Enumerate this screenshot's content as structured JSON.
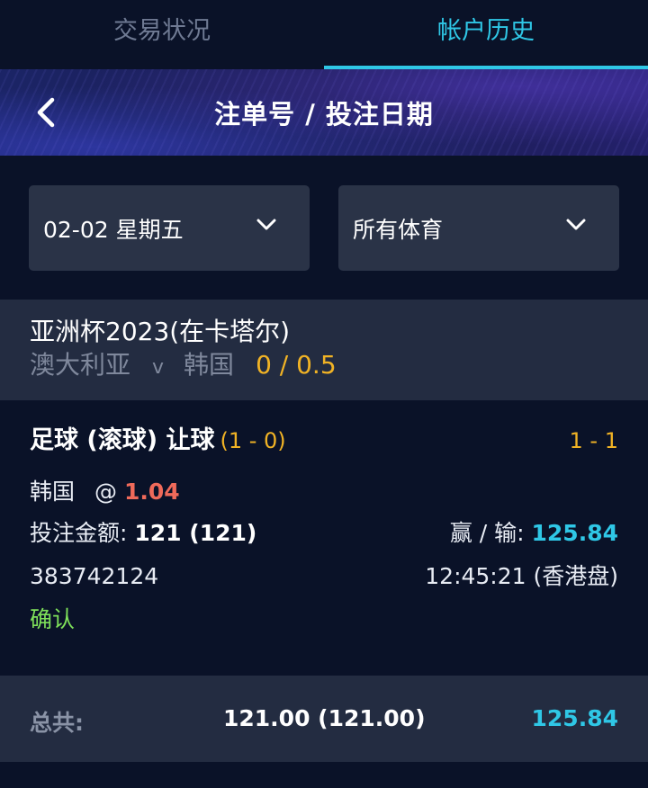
{
  "tabs": [
    {
      "label": "交易状况",
      "active": false
    },
    {
      "label": "帐户历史",
      "active": true
    }
  ],
  "header": {
    "title": "注单号 / 投注日期",
    "back_icon": "chevron-left-icon"
  },
  "filters": {
    "date": {
      "selected": "02-02 星期五"
    },
    "sport": {
      "selected": "所有体育"
    }
  },
  "event": {
    "league": "亚洲杯2023(在卡塔尔)",
    "home": "澳大利亚",
    "vs": "v",
    "away": "韩国",
    "handicap": "0 / 0.5"
  },
  "bet": {
    "market": "足球 (滚球) 让球",
    "market_score": "(1 - 0)",
    "final_score": "1 - 1",
    "selection": "韩国",
    "at": "@",
    "odds": "1.04",
    "stake_label": "投注金额:",
    "stake_value": "121 (121)",
    "winloss_label": "赢 / 输:",
    "winloss_value": "125.84",
    "ticket_id": "383742124",
    "time": "12:45:21 (香港盘)",
    "status": "确认"
  },
  "total": {
    "label": "总共:",
    "stake": "121.00 (121.00)",
    "winloss": "125.84"
  },
  "colors": {
    "accent": "#2fc7e6",
    "handicap": "#f1b325",
    "odds": "#f06a5a",
    "status_ok": "#7ee05a"
  }
}
